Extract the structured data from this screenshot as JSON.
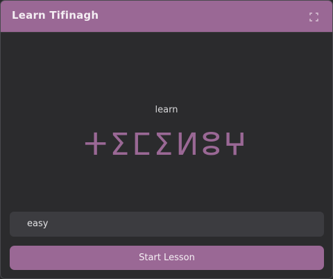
{
  "window": {
    "title": "Learn Tifinagh",
    "fullscreen_icon": "fullscreen-icon"
  },
  "lesson": {
    "prompt_word": "learn",
    "tifinagh_word": "ⵜⵉⵎⵉⵍⵓⵖ"
  },
  "controls": {
    "level_value": "easy",
    "start_label": "Start Lesson"
  },
  "colors": {
    "accent": "#9a6895",
    "background": "#2b2b2d",
    "input_background": "#3c3c40"
  }
}
